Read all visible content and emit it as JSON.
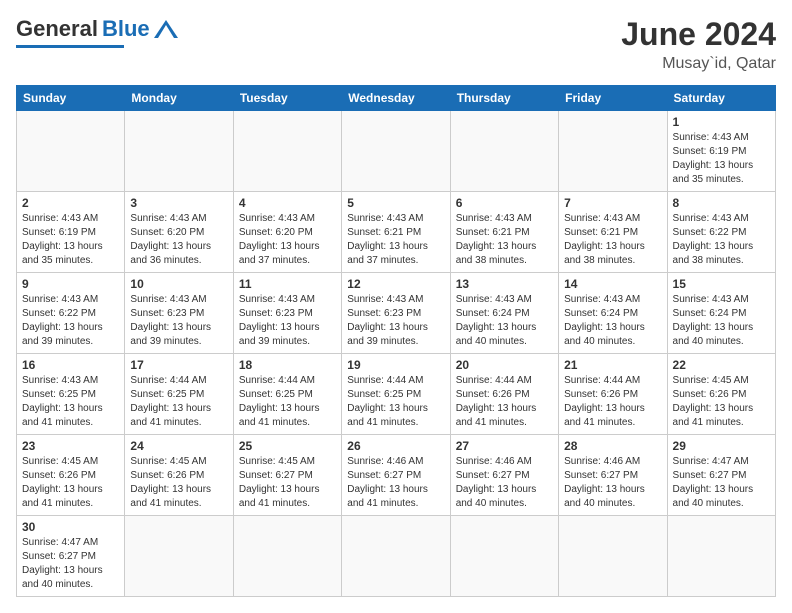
{
  "header": {
    "logo_text_general": "General",
    "logo_text_blue": "Blue",
    "month_year": "June 2024",
    "location": "Musay`id, Qatar"
  },
  "weekdays": [
    "Sunday",
    "Monday",
    "Tuesday",
    "Wednesday",
    "Thursday",
    "Friday",
    "Saturday"
  ],
  "weeks": [
    [
      {
        "day": "",
        "info": ""
      },
      {
        "day": "",
        "info": ""
      },
      {
        "day": "",
        "info": ""
      },
      {
        "day": "",
        "info": ""
      },
      {
        "day": "",
        "info": ""
      },
      {
        "day": "",
        "info": ""
      },
      {
        "day": "1",
        "info": "Sunrise: 4:43 AM\nSunset: 6:19 PM\nDaylight: 13 hours\nand 35 minutes."
      }
    ],
    [
      {
        "day": "2",
        "info": "Sunrise: 4:43 AM\nSunset: 6:19 PM\nDaylight: 13 hours\nand 35 minutes."
      },
      {
        "day": "3",
        "info": "Sunrise: 4:43 AM\nSunset: 6:20 PM\nDaylight: 13 hours\nand 36 minutes."
      },
      {
        "day": "4",
        "info": "Sunrise: 4:43 AM\nSunset: 6:20 PM\nDaylight: 13 hours\nand 37 minutes."
      },
      {
        "day": "5",
        "info": "Sunrise: 4:43 AM\nSunset: 6:21 PM\nDaylight: 13 hours\nand 37 minutes."
      },
      {
        "day": "6",
        "info": "Sunrise: 4:43 AM\nSunset: 6:21 PM\nDaylight: 13 hours\nand 38 minutes."
      },
      {
        "day": "7",
        "info": "Sunrise: 4:43 AM\nSunset: 6:21 PM\nDaylight: 13 hours\nand 38 minutes."
      },
      {
        "day": "8",
        "info": "Sunrise: 4:43 AM\nSunset: 6:22 PM\nDaylight: 13 hours\nand 38 minutes."
      }
    ],
    [
      {
        "day": "9",
        "info": "Sunrise: 4:43 AM\nSunset: 6:22 PM\nDaylight: 13 hours\nand 39 minutes."
      },
      {
        "day": "10",
        "info": "Sunrise: 4:43 AM\nSunset: 6:23 PM\nDaylight: 13 hours\nand 39 minutes."
      },
      {
        "day": "11",
        "info": "Sunrise: 4:43 AM\nSunset: 6:23 PM\nDaylight: 13 hours\nand 39 minutes."
      },
      {
        "day": "12",
        "info": "Sunrise: 4:43 AM\nSunset: 6:23 PM\nDaylight: 13 hours\nand 39 minutes."
      },
      {
        "day": "13",
        "info": "Sunrise: 4:43 AM\nSunset: 6:24 PM\nDaylight: 13 hours\nand 40 minutes."
      },
      {
        "day": "14",
        "info": "Sunrise: 4:43 AM\nSunset: 6:24 PM\nDaylight: 13 hours\nand 40 minutes."
      },
      {
        "day": "15",
        "info": "Sunrise: 4:43 AM\nSunset: 6:24 PM\nDaylight: 13 hours\nand 40 minutes."
      }
    ],
    [
      {
        "day": "16",
        "info": "Sunrise: 4:43 AM\nSunset: 6:25 PM\nDaylight: 13 hours\nand 41 minutes."
      },
      {
        "day": "17",
        "info": "Sunrise: 4:44 AM\nSunset: 6:25 PM\nDaylight: 13 hours\nand 41 minutes."
      },
      {
        "day": "18",
        "info": "Sunrise: 4:44 AM\nSunset: 6:25 PM\nDaylight: 13 hours\nand 41 minutes."
      },
      {
        "day": "19",
        "info": "Sunrise: 4:44 AM\nSunset: 6:25 PM\nDaylight: 13 hours\nand 41 minutes."
      },
      {
        "day": "20",
        "info": "Sunrise: 4:44 AM\nSunset: 6:26 PM\nDaylight: 13 hours\nand 41 minutes."
      },
      {
        "day": "21",
        "info": "Sunrise: 4:44 AM\nSunset: 6:26 PM\nDaylight: 13 hours\nand 41 minutes."
      },
      {
        "day": "22",
        "info": "Sunrise: 4:45 AM\nSunset: 6:26 PM\nDaylight: 13 hours\nand 41 minutes."
      }
    ],
    [
      {
        "day": "23",
        "info": "Sunrise: 4:45 AM\nSunset: 6:26 PM\nDaylight: 13 hours\nand 41 minutes."
      },
      {
        "day": "24",
        "info": "Sunrise: 4:45 AM\nSunset: 6:26 PM\nDaylight: 13 hours\nand 41 minutes."
      },
      {
        "day": "25",
        "info": "Sunrise: 4:45 AM\nSunset: 6:27 PM\nDaylight: 13 hours\nand 41 minutes."
      },
      {
        "day": "26",
        "info": "Sunrise: 4:46 AM\nSunset: 6:27 PM\nDaylight: 13 hours\nand 41 minutes."
      },
      {
        "day": "27",
        "info": "Sunrise: 4:46 AM\nSunset: 6:27 PM\nDaylight: 13 hours\nand 40 minutes."
      },
      {
        "day": "28",
        "info": "Sunrise: 4:46 AM\nSunset: 6:27 PM\nDaylight: 13 hours\nand 40 minutes."
      },
      {
        "day": "29",
        "info": "Sunrise: 4:47 AM\nSunset: 6:27 PM\nDaylight: 13 hours\nand 40 minutes."
      }
    ],
    [
      {
        "day": "30",
        "info": "Sunrise: 4:47 AM\nSunset: 6:27 PM\nDaylight: 13 hours\nand 40 minutes."
      },
      {
        "day": "",
        "info": ""
      },
      {
        "day": "",
        "info": ""
      },
      {
        "day": "",
        "info": ""
      },
      {
        "day": "",
        "info": ""
      },
      {
        "day": "",
        "info": ""
      },
      {
        "day": "",
        "info": ""
      }
    ]
  ]
}
